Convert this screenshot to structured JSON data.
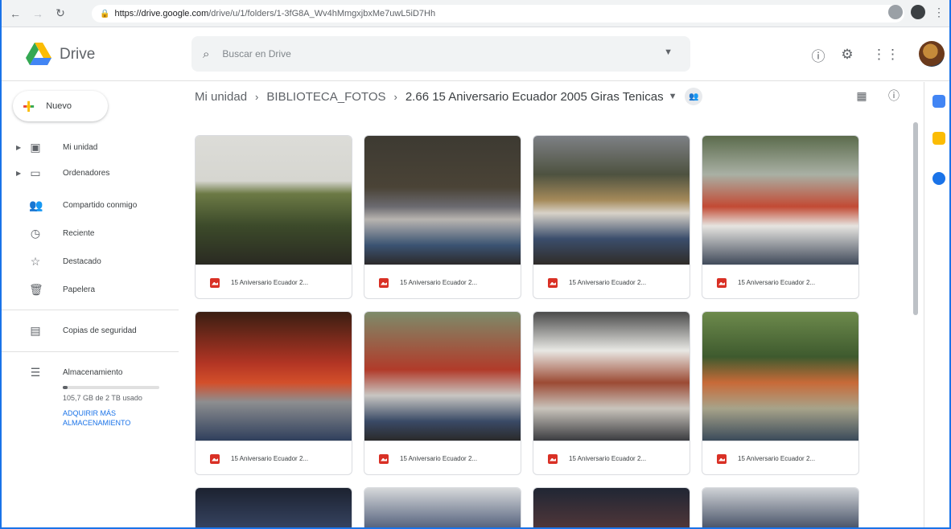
{
  "browser": {
    "url_host": "https://drive.google.com",
    "url_path": "/drive/u/1/folders/1-3fG8A_Wv4hMmgxjbxMe7uwL5iD7Hh"
  },
  "app": {
    "brand": "Drive",
    "search_placeholder": "Buscar en Drive"
  },
  "sidebar": {
    "new_label": "Nuevo",
    "items": [
      {
        "label": "Mi unidad",
        "icon": "drive-folder-icon"
      },
      {
        "label": "Ordenadores",
        "icon": "computer-icon"
      },
      {
        "label": "Compartido conmigo",
        "icon": "people-icon"
      },
      {
        "label": "Reciente",
        "icon": "clock-icon"
      },
      {
        "label": "Destacado",
        "icon": "star-icon"
      },
      {
        "label": "Papelera",
        "icon": "trash-icon"
      },
      {
        "label": "Copias de seguridad",
        "icon": "backup-icon"
      },
      {
        "label": "Almacenamiento",
        "icon": "storage-icon"
      }
    ],
    "storage_used": "105,7 GB de 2 TB usado",
    "storage_fraction": 0.05,
    "buy_storage": "ADQUIRIR MÁS ALMACENAMIENTO"
  },
  "breadcrumb": {
    "root": "Mi unidad",
    "folder": "BIBLIOTECA_FOTOS",
    "current": "2.66 15 Aniversario Ecuador 2005 Giras Tenicas"
  },
  "files": [
    {
      "name": "15 Aniversario Ecuador 2..."
    },
    {
      "name": "15 Aniversario Ecuador 2..."
    },
    {
      "name": "15 Aniversario Ecuador 2..."
    },
    {
      "name": "15 Aniversario Ecuador 2..."
    },
    {
      "name": "15 Aniversario Ecuador 2..."
    },
    {
      "name": "15 Aniversario Ecuador 2..."
    },
    {
      "name": "15 Aniversario Ecuador 2..."
    },
    {
      "name": "15 Aniversario Ecuador 2..."
    }
  ],
  "colors": {
    "accent": "#1a73e8",
    "file_icon": "#d93025"
  }
}
